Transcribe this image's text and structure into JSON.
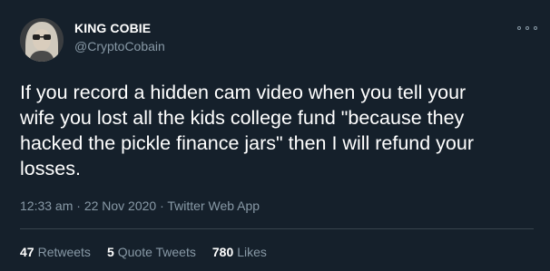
{
  "tweet": {
    "author": {
      "name": "KING COBIE",
      "handle": "@CryptoCobain",
      "avatar": "avatar-photo-icon"
    },
    "more_icon": "more-options-icon",
    "text": "If you record a hidden cam video when you tell your\nwife you lost all the kids college fund \"because they\nhacked the pickle finance jars\" then I will refund your\nlosses.",
    "meta": "12:33 am · 22 Nov 2020 · Twitter Web App",
    "stats": {
      "retweets_count": "47",
      "retweets_label": "Retweets",
      "quote_count": "5",
      "quote_label": "Quote Tweets",
      "likes_count": "780",
      "likes_label": "Likes"
    }
  },
  "colors": {
    "background": "#15202b",
    "primary_text": "#ffffff",
    "secondary_text": "#8899a6",
    "divider": "#38444d"
  }
}
